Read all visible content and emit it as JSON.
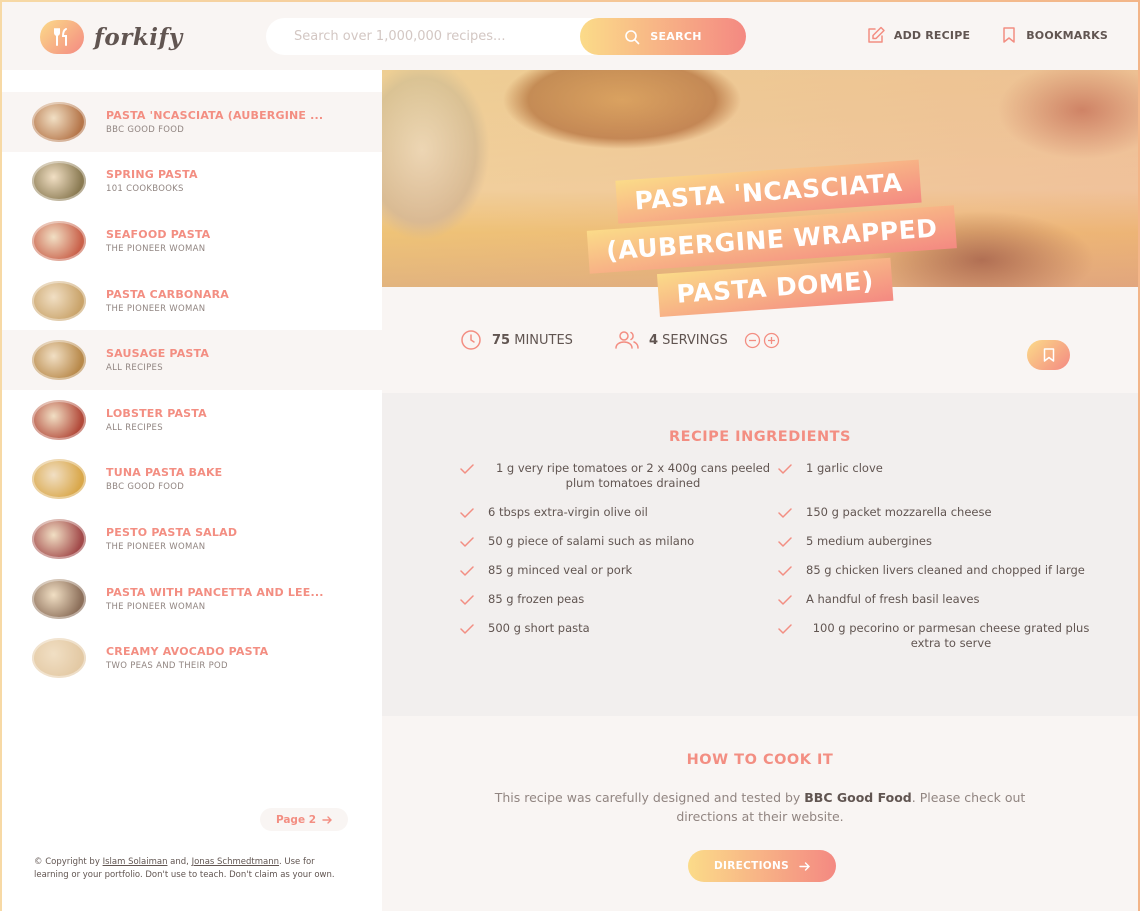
{
  "header": {
    "logo_text": "forkify",
    "search_placeholder": "Search over 1,000,000 recipes...",
    "search_label": "SEARCH",
    "nav": [
      {
        "label": "ADD RECIPE",
        "icon": "edit-icon"
      },
      {
        "label": "BOOKMARKS",
        "icon": "bookmark-icon"
      }
    ]
  },
  "results": [
    {
      "title": "PASTA 'NCASCIATA (AUBERGINE ...",
      "publisher": "BBC GOOD FOOD",
      "active": true,
      "color": "#b5764a"
    },
    {
      "title": "SPRING PASTA",
      "publisher": "101 COOKBOOKS",
      "active": false,
      "color": "#8a7a52"
    },
    {
      "title": "SEAFOOD PASTA",
      "publisher": "THE PIONEER WOMAN",
      "active": false,
      "color": "#c9614a"
    },
    {
      "title": "PASTA CARBONARA",
      "publisher": "THE PIONEER WOMAN",
      "active": false,
      "color": "#c9a36a"
    },
    {
      "title": "SAUSAGE PASTA",
      "publisher": "ALL RECIPES",
      "active": true,
      "color": "#b8894a"
    },
    {
      "title": "LOBSTER PASTA",
      "publisher": "ALL RECIPES",
      "active": false,
      "color": "#b24a3a"
    },
    {
      "title": "TUNA PASTA BAKE",
      "publisher": "BBC GOOD FOOD",
      "active": false,
      "color": "#d9a74a"
    },
    {
      "title": "PESTO PASTA SALAD",
      "publisher": "THE PIONEER WOMAN",
      "active": false,
      "color": "#a24a4a"
    },
    {
      "title": "PASTA WITH PANCETTA AND LEE...",
      "publisher": "THE PIONEER WOMAN",
      "active": false,
      "color": "#8c6f5a"
    },
    {
      "title": "CREAMY AVOCADO PASTA",
      "publisher": "TWO PEAS AND THEIR POD",
      "active": false,
      "color": "#e3c9a4"
    }
  ],
  "pagination": {
    "next_label": "Page 2"
  },
  "copyright": {
    "prefix": "© Copyright by ",
    "author1": "Islam Solaiman",
    "mid": " and, ",
    "author2": "Jonas Schmedtmann",
    "suffix": ". Use for learning or your portfolio. Don't use to teach. Don't claim as your own."
  },
  "recipe": {
    "title_lines": [
      "PASTA 'NCASCIATA",
      "(AUBERGINE WRAPPED",
      "PASTA DOME)"
    ],
    "minutes": "75",
    "minutes_label": "MINUTES",
    "servings": "4",
    "servings_label": "SERVINGS",
    "ingredients_heading": "RECIPE INGREDIENTS",
    "ingredients": [
      "1 g very ripe tomatoes or 2 x 400g cans peeled plum tomatoes drained",
      "1 garlic clove",
      "6 tbsps extra-virgin olive oil",
      "150 g packet mozzarella cheese",
      "50 g piece of salami such as milano",
      "5 medium aubergines",
      "85 g minced veal or pork",
      "85 g chicken livers cleaned and chopped if large",
      "85 g frozen peas",
      "A handful of fresh basil leaves",
      "500 g short pasta",
      "100 g pecorino or parmesan cheese grated plus extra to serve"
    ],
    "cook_heading": "HOW TO COOK IT",
    "cook_text_prefix": "This recipe was carefully designed and tested by ",
    "publisher": "BBC Good Food",
    "cook_text_suffix": ". Please check out directions at their website.",
    "directions_label": "DIRECTIONS"
  },
  "colors": {
    "accent": "#f38e82",
    "gradient_start": "#fbdb89",
    "gradient_end": "#f48982"
  }
}
